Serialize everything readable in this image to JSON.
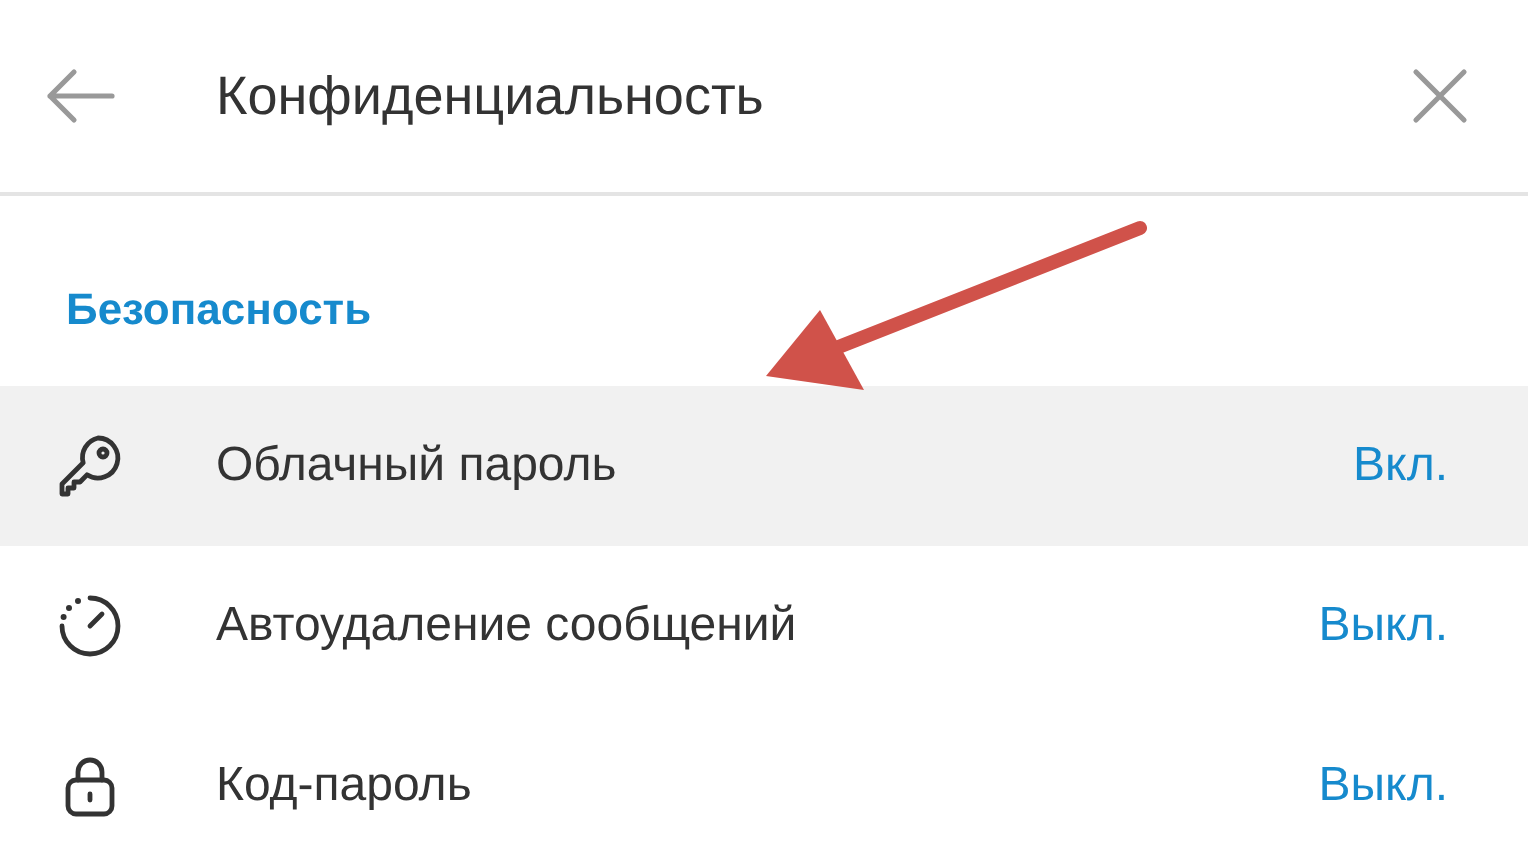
{
  "header": {
    "title": "Конфиденциальность"
  },
  "section": {
    "title": "Безопасность"
  },
  "rows": [
    {
      "kind": "key",
      "label": "Облачный пароль",
      "value": "Вкл.",
      "hovered": true
    },
    {
      "kind": "timer",
      "label": "Автоудаление сообщений",
      "value": "Выкл.",
      "hovered": false
    },
    {
      "kind": "lock",
      "label": "Код-пароль",
      "value": "Выкл.",
      "hovered": false
    }
  ],
  "annotations": [
    {
      "kind": "arrow",
      "color": "#d0524a"
    }
  ]
}
